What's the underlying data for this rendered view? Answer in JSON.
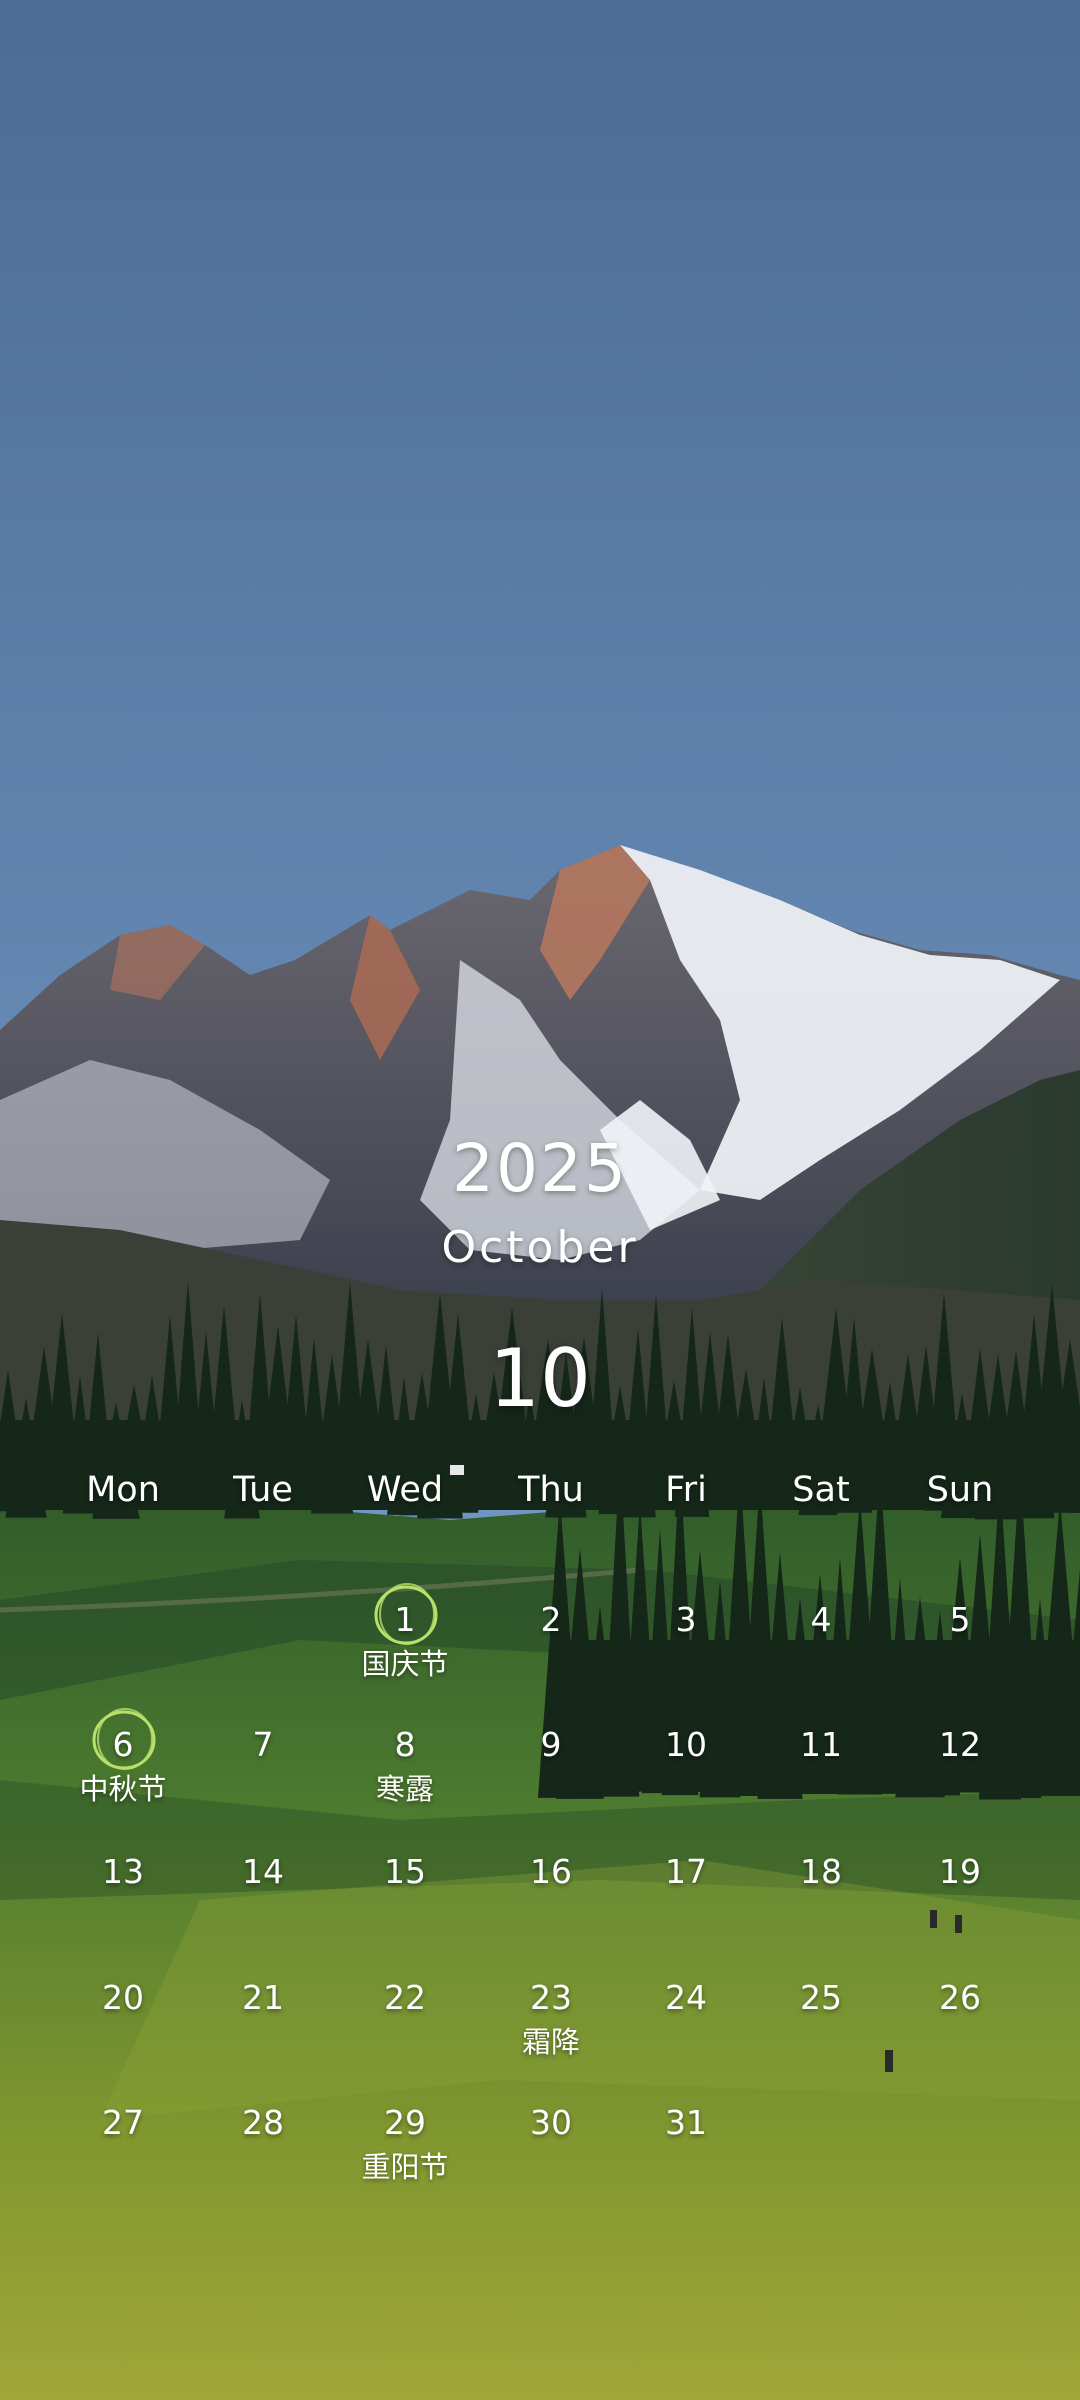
{
  "calendar": {
    "year": "2025",
    "month_name": "October",
    "month_number": "10",
    "weekdays": [
      "Mon",
      "Tue",
      "Wed",
      "Thu",
      "Fri",
      "Sat",
      "Sun"
    ],
    "weeks": [
      [
        null,
        null,
        {
          "day": "1",
          "note": "国庆节",
          "highlighted": true
        },
        {
          "day": "2"
        },
        {
          "day": "3"
        },
        {
          "day": "4"
        },
        {
          "day": "5"
        }
      ],
      [
        {
          "day": "6",
          "note": "中秋节",
          "highlighted": true
        },
        {
          "day": "7"
        },
        {
          "day": "8",
          "note": "寒露"
        },
        {
          "day": "9"
        },
        {
          "day": "10"
        },
        {
          "day": "11"
        },
        {
          "day": "12"
        }
      ],
      [
        {
          "day": "13"
        },
        {
          "day": "14"
        },
        {
          "day": "15"
        },
        {
          "day": "16"
        },
        {
          "day": "17"
        },
        {
          "day": "18"
        },
        {
          "day": "19"
        }
      ],
      [
        {
          "day": "20"
        },
        {
          "day": "21"
        },
        {
          "day": "22"
        },
        {
          "day": "23",
          "note": "霜降"
        },
        {
          "day": "24"
        },
        {
          "day": "25"
        },
        {
          "day": "26"
        }
      ],
      [
        {
          "day": "27"
        },
        {
          "day": "28"
        },
        {
          "day": "29",
          "note": "重阳节"
        },
        {
          "day": "30"
        },
        {
          "day": "31"
        },
        null,
        null
      ]
    ]
  },
  "colors": {
    "sky_top": "#4f6f99",
    "sky_bottom": "#7ea3cc",
    "snow": "#eef0f5",
    "rock": "#5d5f6f",
    "sunlit_rock": "#c07a5e",
    "forest": "#17291c",
    "meadow_light": "#97a63a",
    "meadow_dark": "#3d6a2e",
    "highlight_ring": "#b8e06a"
  },
  "background_description_icon": "mountain-landscape"
}
